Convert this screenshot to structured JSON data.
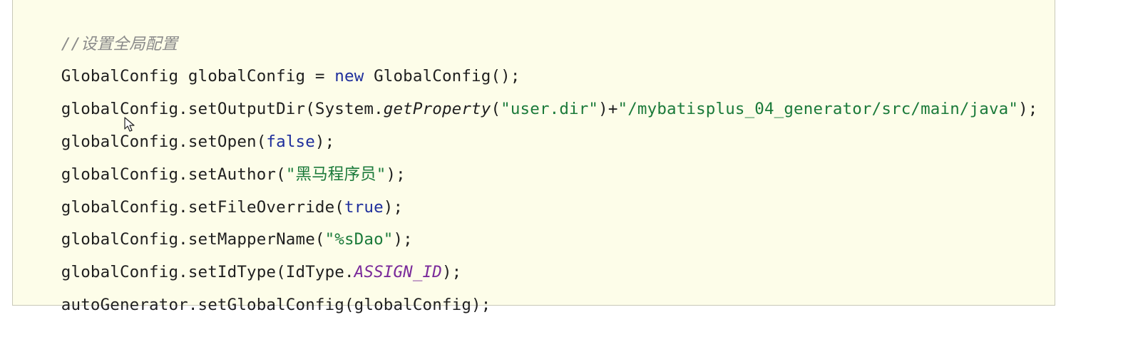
{
  "code": {
    "comment": "//设置全局配置",
    "line1": {
      "a": "GlobalConfig globalConfig = ",
      "kw": "new",
      "b": " GlobalConfig();"
    },
    "line2": {
      "a": "globalConfig.setOutputDir(System.",
      "method": "getProperty",
      "b": "(",
      "s1": "\"user.dir\"",
      "c": ")+",
      "s2": "\"/mybatisplus_04_generator/src/main/java\"",
      "d": ");"
    },
    "line3": {
      "a": "globalConfig.setOpen(",
      "kw": "false",
      "b": ");"
    },
    "line4": {
      "a": "globalConfig.setAuthor(",
      "s": "\"黑马程序员\"",
      "b": ");"
    },
    "line5": {
      "a": "globalConfig.setFileOverride(",
      "kw": "true",
      "b": ");"
    },
    "line6": {
      "a": "globalConfig.setMapperName(",
      "s": "\"%sDao\"",
      "b": ");"
    },
    "line7": {
      "a": "globalConfig.setIdType(IdType.",
      "const": "ASSIGN_ID",
      "b": ");"
    },
    "line8": {
      "a": "autoGenerator.setGlobalConfig(globalConfig);"
    }
  },
  "icons": {
    "cursor": "mouse-pointer-icon"
  }
}
